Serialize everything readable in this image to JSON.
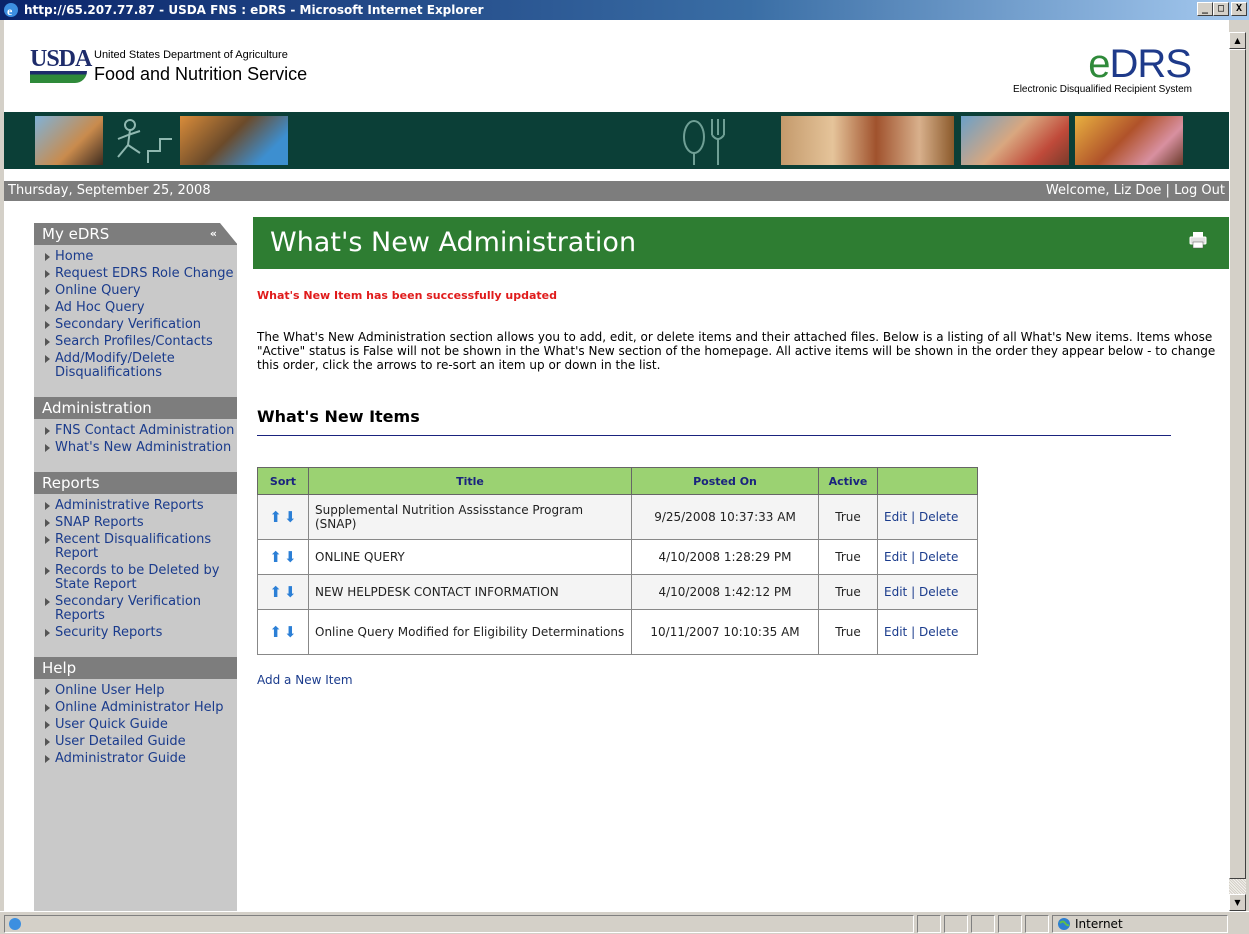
{
  "window": {
    "title": "http://65.207.77.87 - USDA FNS : eDRS - Microsoft Internet Explorer",
    "min_label": "_",
    "max_label": "□",
    "close_label": "X"
  },
  "header": {
    "usda_mark": "USDA",
    "department": "United States Department of Agriculture",
    "agency": "Food and Nutrition Service",
    "app_logo": "eDRS",
    "app_logo_e": "e",
    "app_logo_rest": "DRS",
    "app_subtitle": "Electronic Disqualified Recipient System"
  },
  "datebar": {
    "date": "Thursday, September 25, 2008",
    "welcome": "Welcome, Liz Doe",
    "separator": "|",
    "logout": "Log Out"
  },
  "sidebar": {
    "my_edrs": {
      "title": "My eDRS",
      "collapse": "«",
      "items": [
        "Home",
        "Request EDRS Role Change",
        "Online Query",
        "Ad Hoc Query",
        "Secondary Verification",
        "Search Profiles/Contacts",
        "Add/Modify/Delete Disqualifications"
      ]
    },
    "administration": {
      "title": "Administration",
      "items": [
        "FNS Contact Administration",
        "What's New Administration"
      ]
    },
    "reports": {
      "title": "Reports",
      "items": [
        "Administrative Reports",
        "SNAP Reports",
        "Recent Disqualifications Report",
        "Records to be Deleted by State Report",
        "Secondary Verification Reports",
        "Security Reports"
      ]
    },
    "help": {
      "title": "Help",
      "items": [
        "Online User Help",
        "Online Administrator Help",
        "User Quick Guide",
        "User Detailed Guide",
        "Administrator Guide"
      ]
    }
  },
  "main": {
    "page_title": "What's New Administration",
    "success_message": "What's New Item has been successfully updated",
    "intro": "The What's New Administration section allows you to add, edit, or delete items and their attached files. Below is a listing of all What's New items. Items whose \"Active\" status is False will not be shown in the What's New section of the homepage. All active items will be shown in the order they appear below - to change this order, click the arrows to re-sort an item up or down in the list.",
    "section_title": "What's New Items",
    "table": {
      "headers": {
        "sort": "Sort",
        "title": "Title",
        "posted_on": "Posted On",
        "active": "Active",
        "actions": ""
      },
      "up_arrow": "⬆",
      "down_arrow": "⬇",
      "edit_label": "Edit",
      "action_sep": "|",
      "delete_label": "Delete",
      "rows": [
        {
          "title": "Supplemental Nutrition Assisstance Program (SNAP)",
          "posted_on": "9/25/2008 10:37:33 AM",
          "active": "True"
        },
        {
          "title": "ONLINE QUERY",
          "posted_on": "4/10/2008 1:28:29 PM",
          "active": "True"
        },
        {
          "title": "NEW HELPDESK CONTACT INFORMATION",
          "posted_on": "4/10/2008 1:42:12 PM",
          "active": "True"
        },
        {
          "title": "Online Query Modified for Eligibility Determinations",
          "posted_on": "10/11/2007 10:10:35 AM",
          "active": "True"
        }
      ]
    },
    "add_link": "Add a New Item"
  },
  "statusbar": {
    "zone": "Internet"
  },
  "colors": {
    "page_header_green": "#2e7d32",
    "table_header_green": "#9bd272",
    "link_blue": "#1a3b8c",
    "success_red": "#e01b1b",
    "banner_teal": "#0b3f37"
  }
}
